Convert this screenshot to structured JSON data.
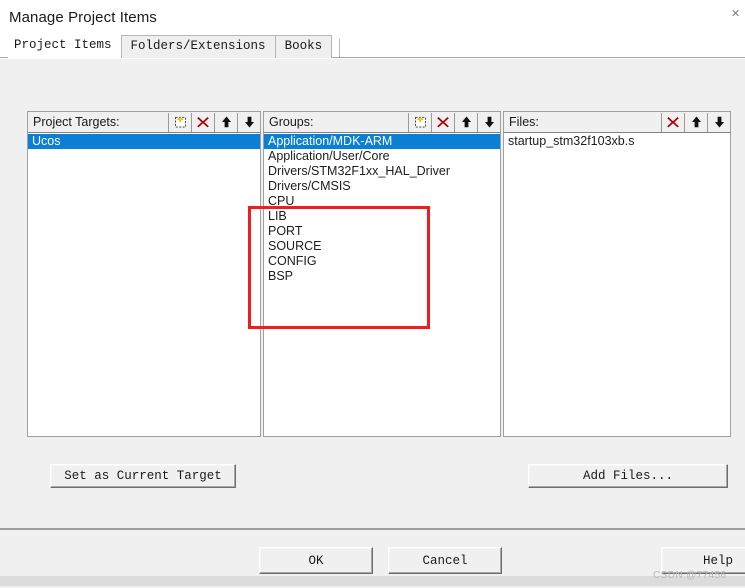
{
  "window": {
    "title": "Manage Project Items",
    "close_icon": "close-icon"
  },
  "tabs": [
    {
      "label": "Project Items",
      "active": true
    },
    {
      "label": "Folders/Extensions",
      "active": false
    },
    {
      "label": "Books",
      "active": false
    }
  ],
  "panels": {
    "project_targets": {
      "label": "Project Targets:",
      "tools": [
        "new-item-icon",
        "delete-icon",
        "move-up-icon",
        "move-down-icon"
      ],
      "items": [
        {
          "label": "Ucos",
          "selected": true
        }
      ]
    },
    "groups": {
      "label": "Groups:",
      "tools": [
        "new-item-icon",
        "delete-icon",
        "move-up-icon",
        "move-down-icon"
      ],
      "items": [
        {
          "label": "Application/MDK-ARM",
          "selected": true
        },
        {
          "label": "Application/User/Core",
          "selected": false
        },
        {
          "label": "Drivers/STM32F1xx_HAL_Driver",
          "selected": false
        },
        {
          "label": "Drivers/CMSIS",
          "selected": false
        },
        {
          "label": "CPU",
          "selected": false
        },
        {
          "label": "LIB",
          "selected": false
        },
        {
          "label": "PORT",
          "selected": false
        },
        {
          "label": "SOURCE",
          "selected": false
        },
        {
          "label": "CONFIG",
          "selected": false
        },
        {
          "label": "BSP",
          "selected": false
        }
      ]
    },
    "files": {
      "label": "Files:",
      "tools": [
        "delete-icon",
        "move-up-icon",
        "move-down-icon"
      ],
      "items": [
        {
          "label": "startup_stm32f103xb.s",
          "selected": false
        }
      ]
    }
  },
  "buttons": {
    "set_as_current_target": "Set as Current Target",
    "add_files": "Add Files...",
    "ok": "OK",
    "cancel": "Cancel",
    "help": "Help"
  },
  "watermark": {
    "text": "CSDN @77456"
  },
  "colors": {
    "selection_blue": "#0a7fd4",
    "annotation_red": "#ef1d1d",
    "dialog_face": "#f0f0f0",
    "delete_icon_red": "#aa0000"
  }
}
